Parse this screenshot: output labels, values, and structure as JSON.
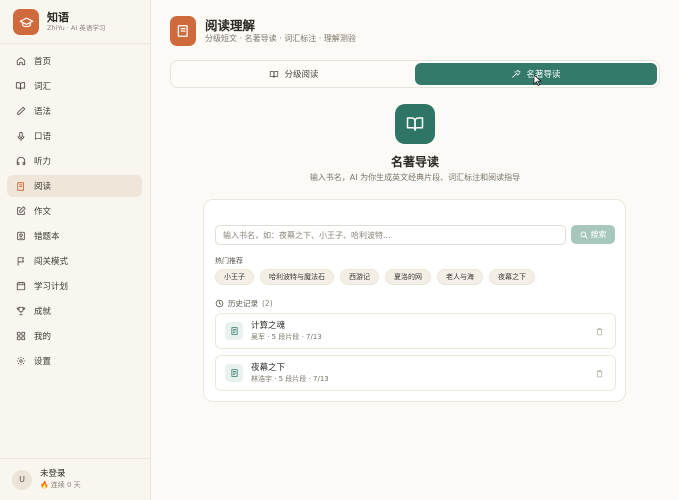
{
  "brand": {
    "name": "知语",
    "subtitle": "ZhiYu · AI 英语学习",
    "color": "#cf6a3c"
  },
  "sidebar": {
    "items": [
      {
        "label": "首页",
        "icon": "home-icon"
      },
      {
        "label": "词汇",
        "icon": "book-open-icon"
      },
      {
        "label": "语法",
        "icon": "pen-icon"
      },
      {
        "label": "口语",
        "icon": "microphone-icon"
      },
      {
        "label": "听力",
        "icon": "headphones-icon"
      },
      {
        "label": "阅读",
        "icon": "book-icon",
        "active": true
      },
      {
        "label": "作文",
        "icon": "edit-icon"
      },
      {
        "label": "错题本",
        "icon": "notebook-icon"
      },
      {
        "label": "闯关模式",
        "icon": "flag-icon"
      },
      {
        "label": "学习计划",
        "icon": "calendar-icon"
      },
      {
        "label": "成就",
        "icon": "trophy-icon"
      },
      {
        "label": "我的",
        "icon": "grid-icon"
      },
      {
        "label": "设置",
        "icon": "gear-icon"
      }
    ]
  },
  "user": {
    "avatar": "U",
    "name": "未登录",
    "streak": "连续 0 天"
  },
  "header": {
    "title": "阅读理解",
    "subtitle": "分级短文 · 名著导读 · 词汇标注 · 理解测验"
  },
  "tabs": [
    {
      "label": "分级阅读",
      "active": false
    },
    {
      "label": "名著导读",
      "active": true
    }
  ],
  "hero": {
    "title": "名著导读",
    "subtitle": "输入书名，AI 为你生成英文经典片段、词汇标注和阅读指导"
  },
  "search": {
    "placeholder": "输入书名，如：夜幕之下、小王子、哈利波特...",
    "button": "搜索"
  },
  "hot": {
    "label": "热门推荐",
    "tags": [
      "小王子",
      "哈利波特与魔法石",
      "西游记",
      "夏洛的网",
      "老人与海",
      "夜幕之下"
    ]
  },
  "history": {
    "label": "历史记录",
    "count": "(2)",
    "items": [
      {
        "title": "计算之魂",
        "meta": "吴军 · 5 段片段 · 7/13"
      },
      {
        "title": "夜幕之下",
        "meta": "林浩宇 · 5 段片段 · 7/13"
      }
    ]
  },
  "colors": {
    "accent": "#cf6a3c",
    "teal": "#347a6b",
    "teal_light": "#a7c6bc",
    "background": "#fcfaf6"
  }
}
